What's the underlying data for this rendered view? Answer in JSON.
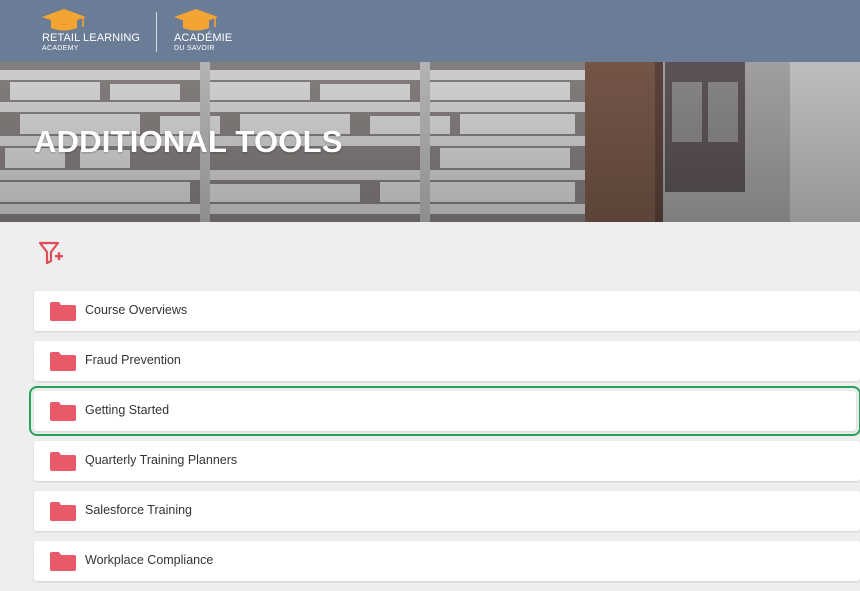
{
  "header": {
    "logo_primary": {
      "line1": "RETAIL LEARNING",
      "line2": "ACADEMY",
      "icon": "graduation-cap-icon"
    },
    "logo_secondary": {
      "line1": "ACADÉMIE",
      "line2": "DU SAVOIR",
      "icon": "graduation-cap-icon"
    }
  },
  "hero": {
    "title": "ADDITIONAL TOOLS"
  },
  "toolbar": {
    "filter_icon": "filter-add-icon"
  },
  "folders": [
    {
      "label": "Course Overviews",
      "icon": "folder-icon",
      "selected": false
    },
    {
      "label": "Fraud Prevention",
      "icon": "folder-icon",
      "selected": false
    },
    {
      "label": "Getting Started",
      "icon": "folder-icon",
      "selected": true
    },
    {
      "label": "Quarterly Training Planners",
      "icon": "folder-icon",
      "selected": false
    },
    {
      "label": "Salesforce Training",
      "icon": "folder-icon",
      "selected": false
    },
    {
      "label": "Workplace Compliance",
      "icon": "folder-icon",
      "selected": false
    }
  ],
  "colors": {
    "header_bg": "#6b7c96",
    "logo_accent": "#f3a432",
    "folder": "#e85a6a",
    "selection_outline": "#27a25a",
    "filter_icon": "#e14b5a"
  }
}
